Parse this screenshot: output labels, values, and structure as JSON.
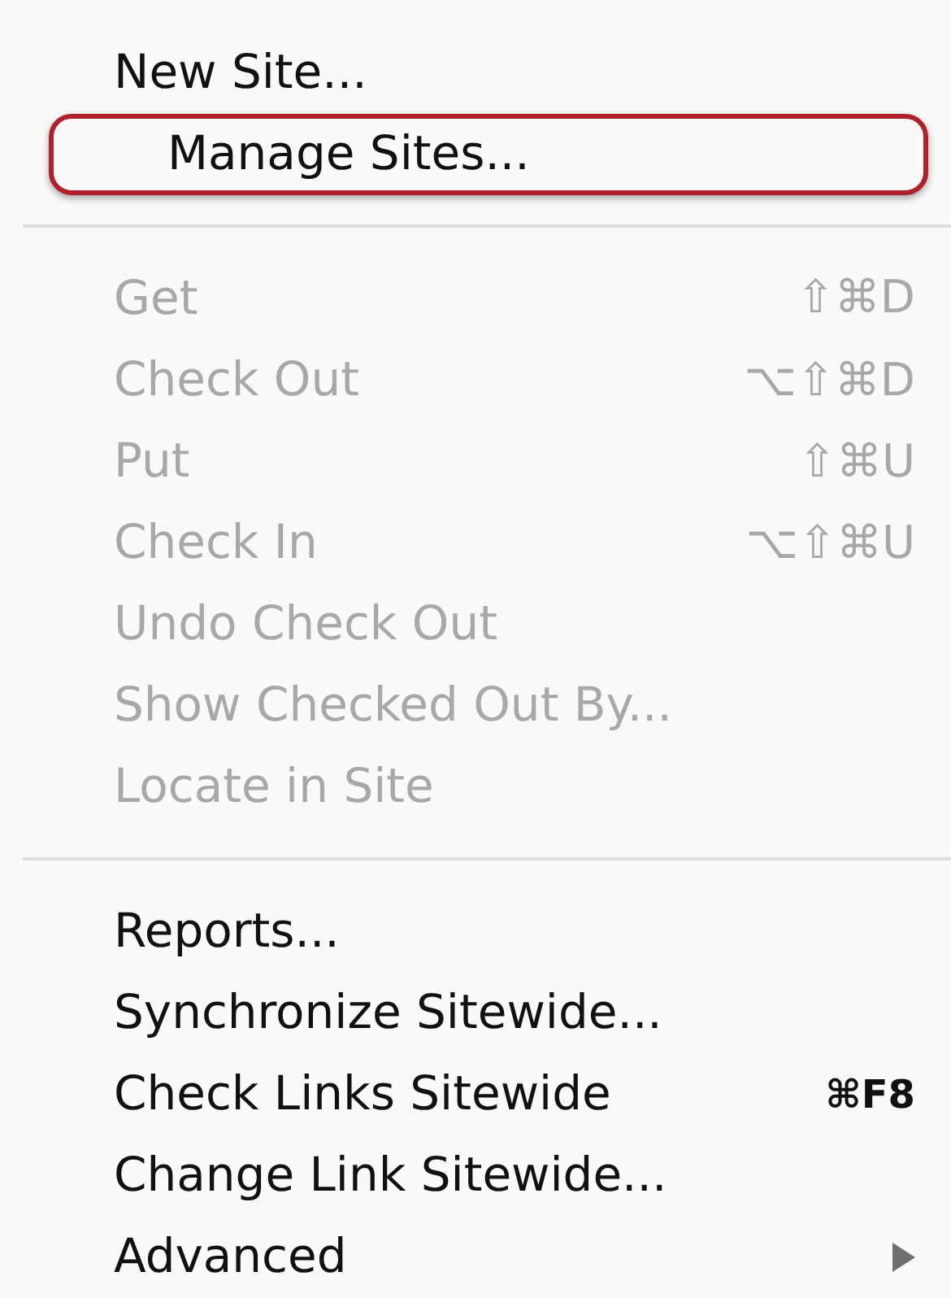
{
  "menu": {
    "items": [
      {
        "kind": "item",
        "label": "New Site...",
        "disabled": false,
        "circled": false
      },
      {
        "kind": "item",
        "label": "Manage Sites...",
        "disabled": false,
        "circled": true
      },
      {
        "kind": "separator"
      },
      {
        "kind": "item",
        "label": "Get",
        "shortcut": "⇧⌘D",
        "disabled": true,
        "circled": false
      },
      {
        "kind": "item",
        "label": "Check Out",
        "shortcut": "⌥⇧⌘D",
        "disabled": true,
        "circled": false
      },
      {
        "kind": "item",
        "label": "Put",
        "shortcut": "⇧⌘U",
        "disabled": true,
        "circled": false
      },
      {
        "kind": "item",
        "label": "Check In",
        "shortcut": "⌥⇧⌘U",
        "disabled": true,
        "circled": false
      },
      {
        "kind": "item",
        "label": "Undo Check Out",
        "disabled": true,
        "circled": false
      },
      {
        "kind": "item",
        "label": "Show Checked Out By...",
        "disabled": true,
        "circled": false
      },
      {
        "kind": "item",
        "label": "Locate in Site",
        "disabled": true,
        "circled": false
      },
      {
        "kind": "separator"
      },
      {
        "kind": "item",
        "label": "Reports...",
        "disabled": false,
        "circled": false
      },
      {
        "kind": "item",
        "label": "Synchronize Sitewide...",
        "disabled": false,
        "circled": false
      },
      {
        "kind": "item",
        "label": "Check Links Sitewide",
        "shortcut": "⌘F8",
        "disabled": false,
        "circled": false
      },
      {
        "kind": "item",
        "label": "Change Link Sitewide...",
        "disabled": false,
        "circled": false
      },
      {
        "kind": "item",
        "label": "Advanced",
        "disabled": false,
        "circled": false,
        "submenu": true
      }
    ]
  }
}
